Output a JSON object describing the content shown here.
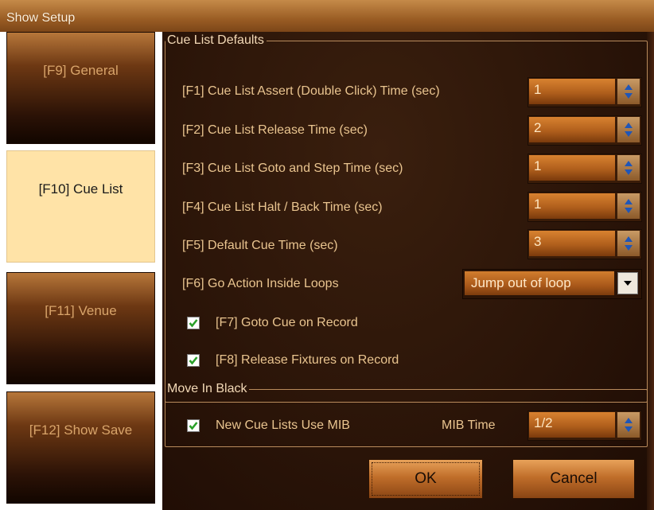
{
  "window": {
    "title": "Show Setup"
  },
  "sidebar": {
    "tabs": [
      {
        "label": "[F9] General",
        "active": false
      },
      {
        "label": "[F10] Cue List",
        "active": true
      },
      {
        "label": "[F11] Venue",
        "active": false
      },
      {
        "label": "[F12] Show Save",
        "active": false
      }
    ]
  },
  "cue_list_defaults": {
    "legend": "Cue List Defaults",
    "rows": [
      {
        "label": "[F1] Cue List Assert (Double Click) Time (sec)",
        "value": "1"
      },
      {
        "label": "[F2] Cue List Release Time (sec)",
        "value": "2"
      },
      {
        "label": "[F3] Cue List Goto and Step Time (sec)",
        "value": "1"
      },
      {
        "label": "[F4] Cue List Halt / Back Time (sec)",
        "value": "1"
      },
      {
        "label": "[F5] Default Cue Time (sec)",
        "value": "3"
      }
    ],
    "go_action": {
      "label": "[F6] Go Action Inside Loops",
      "value": "Jump out of loop"
    },
    "goto_cue": {
      "label": "[F7] Goto Cue on Record",
      "checked": true
    },
    "release_fixtures": {
      "label": "[F8] Release Fixtures on Record",
      "checked": true
    }
  },
  "move_in_black": {
    "legend": "Move In Black",
    "use_mib": {
      "label": "New Cue Lists Use MIB",
      "checked": true
    },
    "mib_time": {
      "label": "MIB Time",
      "value": "1/2"
    }
  },
  "buttons": {
    "ok": "OK",
    "cancel": "Cancel"
  },
  "colors": {
    "accent": "#c06e2a",
    "active_tab": "#ffe3a7",
    "label_text": "#e9c48f",
    "check": "#2aa02a"
  }
}
